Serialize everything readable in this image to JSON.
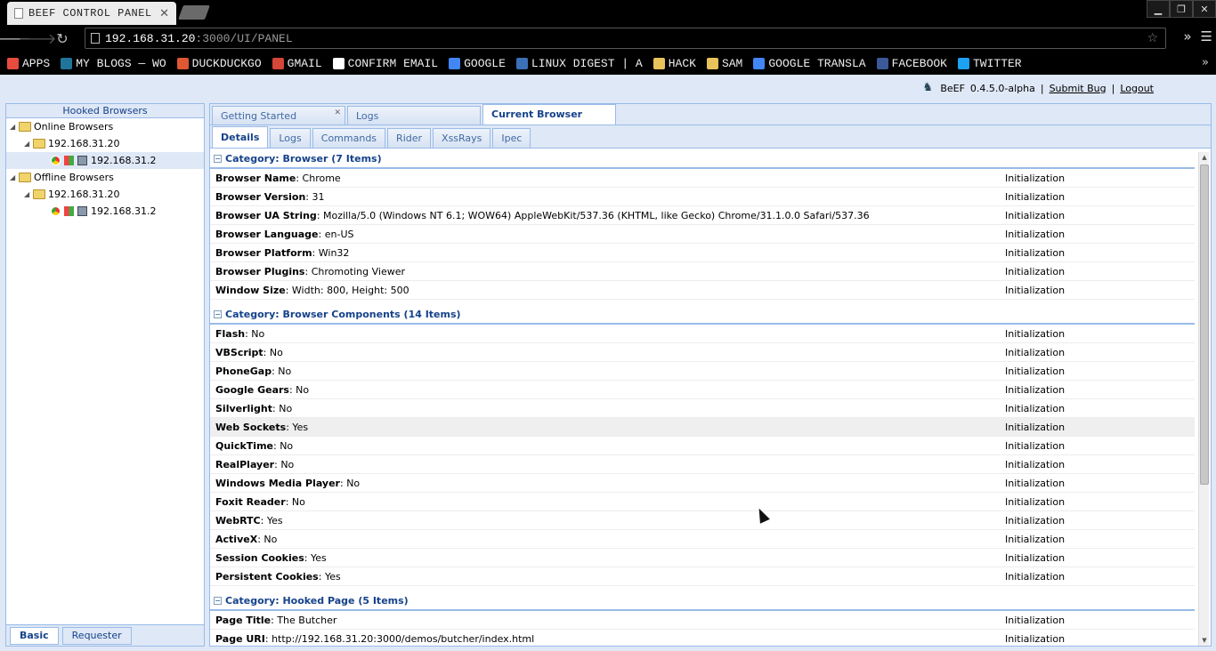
{
  "browser": {
    "tab_title": "BEEF CONTROL PANEL",
    "url_host": "192.168.31.20",
    "url_rest": ":3000/UI/PANEL",
    "bookmarks": [
      {
        "label": "APPS",
        "icon": "apps-grid-icon",
        "color": "#e74c3c"
      },
      {
        "label": "MY BLOGS — WO",
        "icon": "wordpress-icon",
        "color": "#21759b"
      },
      {
        "label": "DUCKDUCKGO",
        "icon": "duckduckgo-icon",
        "color": "#de5833"
      },
      {
        "label": "GMAIL",
        "icon": "gmail-icon",
        "color": "#d44638"
      },
      {
        "label": "CONFIRM EMAIL",
        "icon": "page-icon",
        "color": "#ffffff"
      },
      {
        "label": "GOOGLE",
        "icon": "google-icon",
        "color": "#4285f4"
      },
      {
        "label": "LINUX DIGEST | A",
        "icon": "linux-icon",
        "color": "#3b6fb6"
      },
      {
        "label": "HACK",
        "icon": "folder-icon",
        "color": "#e8c25a"
      },
      {
        "label": "SAM",
        "icon": "folder-icon",
        "color": "#e8c25a"
      },
      {
        "label": "GOOGLE TRANSLA",
        "icon": "translate-icon",
        "color": "#4285f4"
      },
      {
        "label": "FACEBOOK",
        "icon": "facebook-icon",
        "color": "#3b5998"
      },
      {
        "label": "TWITTER",
        "icon": "twitter-icon",
        "color": "#1da1f2"
      }
    ]
  },
  "header": {
    "product": "BeEF",
    "version": "0.4.5.0-alpha",
    "sep": "|",
    "submit_bug": "Submit Bug",
    "logout": "Logout"
  },
  "left": {
    "title": "Hooked Browsers",
    "online": "Online Browsers",
    "online_host": "192.168.31.20",
    "online_client": "192.168.31.2",
    "offline": "Offline Browsers",
    "offline_host": "192.168.31.20",
    "offline_client": "192.168.31.2",
    "tabs": [
      "Basic",
      "Requester"
    ]
  },
  "main": {
    "tabs": [
      "Getting Started",
      "Logs",
      "Current Browser"
    ],
    "subtabs": [
      "Details",
      "Logs",
      "Commands",
      "Rider",
      "XssRays",
      "Ipec"
    ],
    "categories": [
      {
        "title": "Category: Browser (7 Items)",
        "rows": [
          {
            "k": "Browser Name",
            "v": "Chrome",
            "s": "Initialization"
          },
          {
            "k": "Browser Version",
            "v": "31",
            "s": "Initialization"
          },
          {
            "k": "Browser UA String",
            "v": "Mozilla/5.0 (Windows NT 6.1; WOW64) AppleWebKit/537.36 (KHTML, like Gecko) Chrome/31.1.0.0 Safari/537.36",
            "s": "Initialization"
          },
          {
            "k": "Browser Language",
            "v": "en-US",
            "s": "Initialization"
          },
          {
            "k": "Browser Platform",
            "v": "Win32",
            "s": "Initialization"
          },
          {
            "k": "Browser Plugins",
            "v": "Chromoting Viewer",
            "s": "Initialization"
          },
          {
            "k": "Window Size",
            "v": "Width: 800, Height: 500",
            "s": "Initialization"
          }
        ]
      },
      {
        "title": "Category: Browser Components (14 Items)",
        "rows": [
          {
            "k": "Flash",
            "v": "No",
            "s": "Initialization"
          },
          {
            "k": "VBScript",
            "v": "No",
            "s": "Initialization"
          },
          {
            "k": "PhoneGap",
            "v": "No",
            "s": "Initialization"
          },
          {
            "k": "Google Gears",
            "v": "No",
            "s": "Initialization"
          },
          {
            "k": "Silverlight",
            "v": "No",
            "s": "Initialization"
          },
          {
            "k": "Web Sockets",
            "v": "Yes",
            "s": "Initialization"
          },
          {
            "k": "QuickTime",
            "v": "No",
            "s": "Initialization"
          },
          {
            "k": "RealPlayer",
            "v": "No",
            "s": "Initialization"
          },
          {
            "k": "Windows Media Player",
            "v": "No",
            "s": "Initialization"
          },
          {
            "k": "Foxit Reader",
            "v": "No",
            "s": "Initialization"
          },
          {
            "k": "WebRTC",
            "v": "Yes",
            "s": "Initialization"
          },
          {
            "k": "ActiveX",
            "v": "No",
            "s": "Initialization"
          },
          {
            "k": "Session Cookies",
            "v": "Yes",
            "s": "Initialization"
          },
          {
            "k": "Persistent Cookies",
            "v": "Yes",
            "s": "Initialization"
          }
        ]
      },
      {
        "title": "Category: Hooked Page (5 Items)",
        "rows": [
          {
            "k": "Page Title",
            "v": "The Butcher",
            "s": "Initialization"
          },
          {
            "k": "Page URI",
            "v": "http://192.168.31.20:3000/demos/butcher/index.html",
            "s": "Initialization"
          }
        ]
      }
    ],
    "hover_row": "Web Sockets"
  }
}
